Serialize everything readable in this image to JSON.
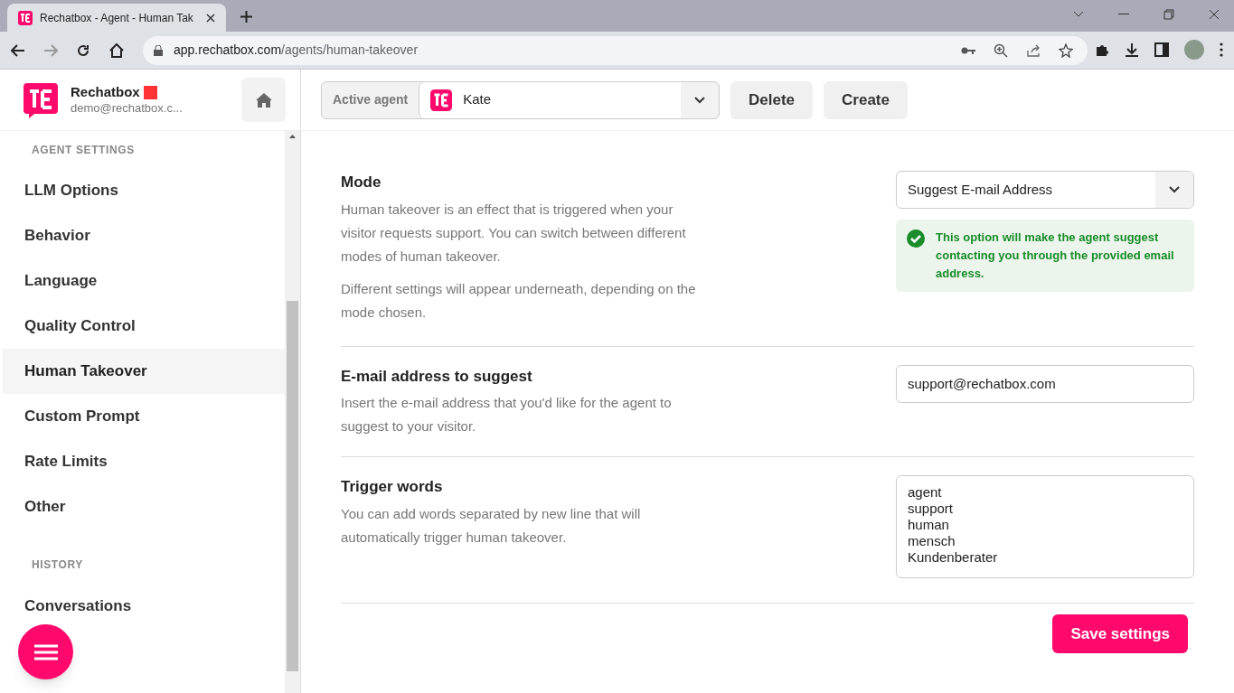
{
  "browser": {
    "tab_title": "Rechatbox - Agent - Human Tak",
    "url_domain": "app.rechatbox.com",
    "url_path": "/agents/human-takeover"
  },
  "brand": {
    "name": "Rechatbox",
    "email": "demo@rechatbox.c..."
  },
  "sidebar": {
    "sections": [
      {
        "heading": "AGENT SETTINGS",
        "items": [
          {
            "label": "LLM Options",
            "selected": false
          },
          {
            "label": "Behavior",
            "selected": false
          },
          {
            "label": "Language",
            "selected": false
          },
          {
            "label": "Quality Control",
            "selected": false
          },
          {
            "label": "Human Takeover",
            "selected": true
          },
          {
            "label": "Custom Prompt",
            "selected": false
          },
          {
            "label": "Rate Limits",
            "selected": false
          },
          {
            "label": "Other",
            "selected": false
          }
        ]
      },
      {
        "heading": "HISTORY",
        "items": [
          {
            "label": "Conversations",
            "selected": false
          }
        ]
      }
    ]
  },
  "toolbar": {
    "agent_label": "Active agent",
    "agent_value": "Kate",
    "buttons": [
      "Delete",
      "Create"
    ]
  },
  "settings": [
    {
      "kind": "select",
      "title": "Mode",
      "paragraphs": [
        "Human takeover is an effect that is triggered when your visitor requests support. You can switch between different modes of human takeover.",
        "Different settings will appear underneath, depending on the mode chosen."
      ],
      "value": "Suggest E-mail Address",
      "note": "This option will make the agent suggest contacting you through the provided email address."
    },
    {
      "kind": "input",
      "title": "E-mail address to suggest",
      "paragraphs": [
        "Insert the e-mail address that you'd like for the agent to suggest to your visitor."
      ],
      "value": "support@rechatbox.com"
    },
    {
      "kind": "textarea",
      "title": "Trigger words",
      "paragraphs": [
        "You can add words separated by new line that will automatically trigger human takeover."
      ],
      "value": "agent\nsupport\nhuman\nmensch\nKundenberater"
    }
  ],
  "save_button": "Save settings"
}
